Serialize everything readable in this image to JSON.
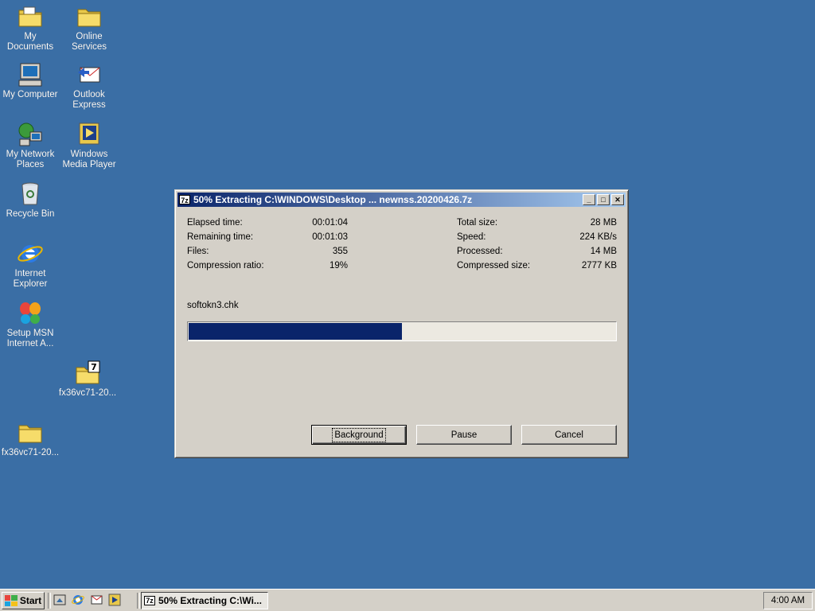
{
  "desktop": {
    "icons": [
      {
        "label": "My Documents"
      },
      {
        "label": "Online Services"
      },
      {
        "label": "My Computer"
      },
      {
        "label": "Outlook Express"
      },
      {
        "label": "My Network Places"
      },
      {
        "label": "Windows Media Player"
      },
      {
        "label": "Recycle Bin"
      },
      {
        "label": "Internet Explorer"
      },
      {
        "label": "Setup MSN Internet A..."
      },
      {
        "label": "fx36vc71-20..."
      },
      {
        "label": "fx36vc71-20..."
      }
    ]
  },
  "dialog": {
    "title_icon": "7z",
    "title": "50% Extracting C:\\WINDOWS\\Desktop ... newnss.20200426.7z",
    "stats": {
      "elapsed_label": "Elapsed time:",
      "elapsed_value": "00:01:04",
      "remaining_label": "Remaining time:",
      "remaining_value": "00:01:03",
      "files_label": "Files:",
      "files_value": "355",
      "ratio_label": "Compression ratio:",
      "ratio_value": "19%",
      "total_label": "Total size:",
      "total_value": "28 MB",
      "speed_label": "Speed:",
      "speed_value": "224 KB/s",
      "processed_label": "Processed:",
      "processed_value": "14 MB",
      "compressed_label": "Compressed size:",
      "compressed_value": "2777 KB"
    },
    "current_file": "softokn3.chk",
    "progress_percent": 50,
    "buttons": {
      "background": "Background",
      "pause": "Pause",
      "cancel": "Cancel"
    }
  },
  "taskbar": {
    "start_label": "Start",
    "task_icon": "7z",
    "task_label": "50% Extracting C:\\Wi...",
    "clock": "4:00 AM"
  },
  "colors": {
    "desktop": "#3a6ea5",
    "titlebar_start": "#0a246a",
    "titlebar_end": "#a6caf0",
    "progress_fill": "#0a246a",
    "face": "#d4d0c8"
  }
}
